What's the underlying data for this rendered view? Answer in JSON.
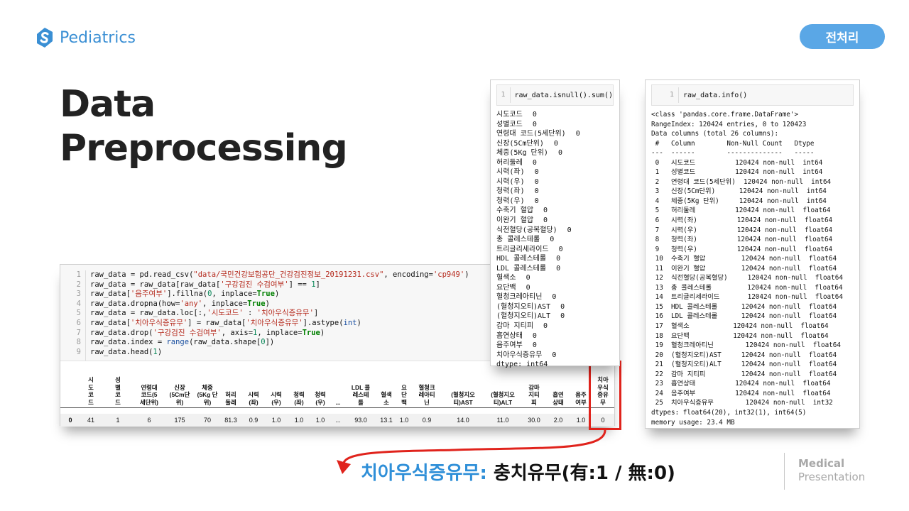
{
  "header": {
    "brand": "Pediatrics",
    "section": "전처리"
  },
  "title": {
    "line1": "Data",
    "line2": "Preprocessing"
  },
  "code_cell": {
    "line_numbers": [
      "1",
      "2",
      "3",
      "4",
      "5",
      "6",
      "7",
      "8",
      "9"
    ],
    "lines": [
      "raw_data = pd.read_csv(\"data/국민건강보험공단_건강검진정보_20191231.csv\", encoding='cp949')",
      "raw_data = raw_data[raw_data['구강검진 수검여부'] == 1]",
      "raw_data['음주여부'].fillna(0, inplace=True)",
      "raw_data.dropna(how='any', inplace=True)",
      "raw_data = raw_data.loc[:,'시도코드' : '치아우식증유무']",
      "raw_data['치아우식증유무'] = raw_data['치아우식증유무'].astype(int)",
      "raw_data.drop('구강검진 수검여부', axis=1, inplace=True)",
      "raw_data.index = range(raw_data.shape[0])",
      "raw_data.head(1)"
    ]
  },
  "dataframe": {
    "columns": [
      "시\n도\n코\n드",
      "성\n별\n코\n드",
      "연령대\n코드(5\n세단위)",
      "신장\n(5Cm단\n위)",
      "체중\n(5Kg 단\n위)",
      "허리\n둘레",
      "시력\n(좌)",
      "시력\n(우)",
      "청력\n(좌)",
      "청력\n(우)",
      "...",
      "LDL 콜\n레스테\n롤",
      "혈색\n소",
      "요\n단\n백",
      "혈청크\n레아티\n닌",
      "(혈청지오\n티)AST",
      "(혈청지오\n티)ALT",
      "감마\n지티\n피",
      "흡연\n상태",
      "음주\n여부",
      "치아\n우식\n증유\n무"
    ],
    "row": [
      "0",
      "41",
      "1",
      "6",
      "175",
      "70",
      "81.3",
      "0.9",
      "1.0",
      "1.0",
      "1.0",
      "...",
      "93.0",
      "13.1",
      "1.0",
      "0.9",
      "14.0",
      "11.0",
      "30.0",
      "2.0",
      "1.0",
      "0"
    ]
  },
  "isnull_cell": {
    "line_number": "1",
    "code": "raw_data.isnull().sum()",
    "rows": [
      [
        "시도코드",
        "0"
      ],
      [
        "성별코드",
        "0"
      ],
      [
        "연령대 코드(5세단위)",
        "0"
      ],
      [
        "신장(5Cm단위)",
        "0"
      ],
      [
        "체중(5Kg 단위)",
        "0"
      ],
      [
        "허리둘레",
        "0"
      ],
      [
        "시력(좌)",
        "0"
      ],
      [
        "시력(우)",
        "0"
      ],
      [
        "청력(좌)",
        "0"
      ],
      [
        "청력(우)",
        "0"
      ],
      [
        "수축기 혈압",
        "0"
      ],
      [
        "이완기 혈압",
        "0"
      ],
      [
        "식전혈당(공복혈당)",
        "0"
      ],
      [
        "총 콜레스테롤",
        "0"
      ],
      [
        "트리글리세라이드",
        "0"
      ],
      [
        "HDL 콜레스테롤",
        "0"
      ],
      [
        "LDL 콜레스테롤",
        "0"
      ],
      [
        "혈색소",
        "0"
      ],
      [
        "요단백",
        "0"
      ],
      [
        "혈청크레아티닌",
        "0"
      ],
      [
        "(혈청지오티)AST",
        "0"
      ],
      [
        "(혈청지오티)ALT",
        "0"
      ],
      [
        "감마 지티피",
        "0"
      ],
      [
        "흡연상태",
        "0"
      ],
      [
        "음주여부",
        "0"
      ],
      [
        "치아우식증유무",
        "0"
      ]
    ],
    "dtype": "dtype: int64"
  },
  "info_cell": {
    "line_number": "1",
    "code": "raw_data.info()",
    "output": [
      "<class 'pandas.core.frame.DataFrame'>",
      "RangeIndex: 120424 entries, 0 to 120423",
      "Data columns (total 26 columns):",
      " #   Column        Non-Null Count   Dtype",
      "---  ------        --------------   -----",
      " 0   시도코드          120424 non-null  int64",
      " 1   성별코드          120424 non-null  int64",
      " 2   연령대 코드(5세단위)  120424 non-null  int64",
      " 3   신장(5Cm단위)      120424 non-null  int64",
      " 4   체중(5Kg 단위)     120424 non-null  int64",
      " 5   허리둘레          120424 non-null  float64",
      " 6   시력(좌)          120424 non-null  float64",
      " 7   시력(우)          120424 non-null  float64",
      " 8   청력(좌)          120424 non-null  float64",
      " 9   청력(우)          120424 non-null  float64",
      " 10  수축기 혈압         120424 non-null  float64",
      " 11  이완기 혈압         120424 non-null  float64",
      " 12  식전혈당(공복혈당)     120424 non-null  float64",
      " 13  총 콜레스테롤         120424 non-null  float64",
      " 14  트리글리세라이드       120424 non-null  float64",
      " 15  HDL 콜레스테롤      120424 non-null  float64",
      " 16  LDL 콜레스테롤      120424 non-null  float64",
      " 17  혈색소           120424 non-null  float64",
      " 18  요단백           120424 non-null  float64",
      " 19  혈청크레아티닌        120424 non-null  float64",
      " 20  (혈청지오티)AST     120424 non-null  float64",
      " 21  (혈청지오티)ALT     120424 non-null  float64",
      " 22  감마 지티피         120424 non-null  float64",
      " 23  흡연상태          120424 non-null  float64",
      " 24  음주여부          120424 non-null  float64",
      " 25  치아우식증유무        120424 non-null  int32",
      "dtypes: float64(20), int32(1), int64(5)",
      "memory usage: 23.4 MB"
    ]
  },
  "caption": {
    "key": "치아우식증유무:",
    "rest": " 충치유무(有:1 / 無:0)"
  },
  "footer": {
    "line1": "Medical",
    "line2": "Presentation"
  },
  "colors": {
    "accent": "#3a8fd4",
    "pill": "#5aa7e6",
    "highlight": "#e0231c"
  }
}
